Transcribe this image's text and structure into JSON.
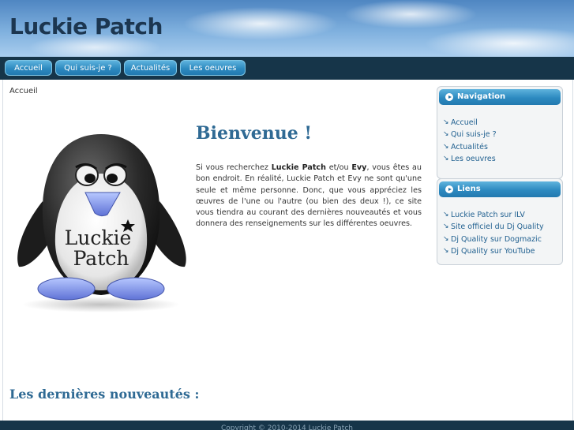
{
  "site": {
    "title": "Luckie Patch"
  },
  "nav": {
    "items": [
      "Accueil",
      "Qui suis-je ?",
      "Actualités",
      "Les oeuvres"
    ]
  },
  "breadcrumb": "Accueil",
  "logo": {
    "line1": "Luckie",
    "line2": "Patch"
  },
  "main": {
    "title": "Bienvenue !",
    "intro": {
      "p1": "Si vous recherchez ",
      "b1": "Luckie Patch",
      "p2": " et/ou ",
      "b2": "Evy",
      "p3": ", vous êtes au bon endroit. En réalité, Luckie Patch et Evy ne sont qu'une seule et même personne. Donc, que vous appréciez les œuvres de l'une ou l'autre (ou bien des deux !), ce site vous tiendra au courant des dernières nouveautés et vous donnera des renseignements sur les différentes oeuvres."
    },
    "latest_title": "Les dernières nouveautés :"
  },
  "sidebar": {
    "navigation": {
      "title": "Navigation",
      "links": [
        "Accueil",
        "Qui suis-je ?",
        "Actualités",
        "Les oeuvres"
      ]
    },
    "liens": {
      "title": "Liens",
      "links": [
        "Luckie Patch sur ILV",
        "Site officiel du Dj Quality",
        "Dj Quality sur Dogmazic",
        "Dj Quality sur YouTube"
      ]
    }
  },
  "footer": {
    "text": "Copyright © 2010-2014 Luckie Patch"
  },
  "colors": {
    "navbar": "#163549",
    "accent": "#2f6a94",
    "link": "#1f5f8f",
    "button": "#2d8ac0"
  }
}
